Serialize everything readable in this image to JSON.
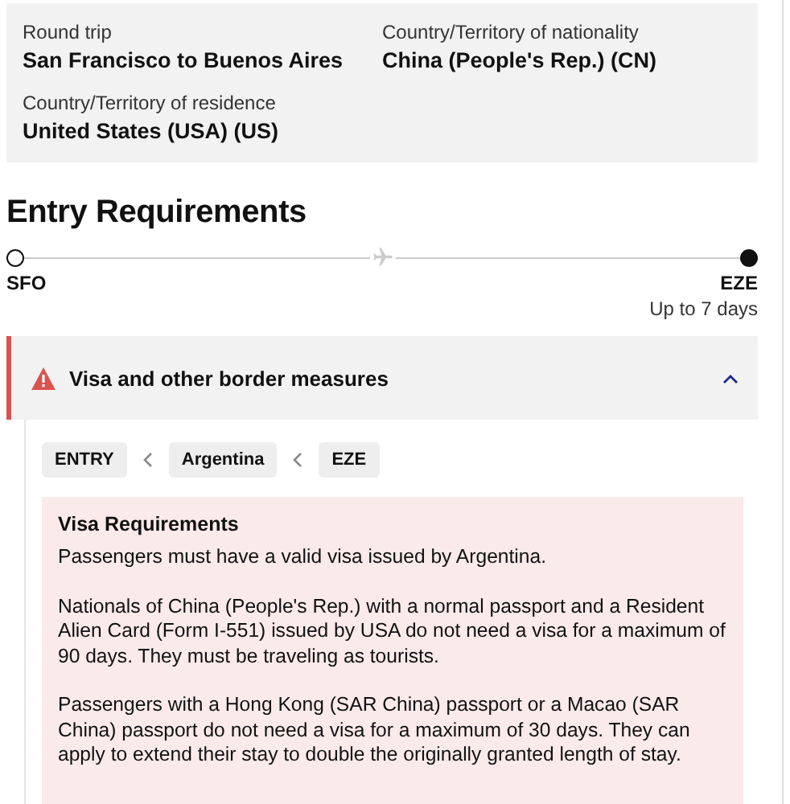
{
  "summary": [
    {
      "label": "Round trip",
      "value": "San Francisco to Buenos Aires"
    },
    {
      "label": "Country/Territory of nationality",
      "value": "China (People's Rep.) (CN)"
    },
    {
      "label": "Country/Territory of residence",
      "value": "United States (USA) (US)"
    }
  ],
  "heading": "Entry Requirements",
  "route": {
    "stops": [
      {
        "code": "SFO",
        "current": false
      },
      {
        "code": "EZE",
        "current": true,
        "note": "Up to 7 days"
      }
    ]
  },
  "section": {
    "title": "Visa and other border measures",
    "expanded": true,
    "breadcrumb": [
      "ENTRY",
      "Argentina",
      "EZE"
    ],
    "notice": {
      "title": "Visa Requirements",
      "paragraphs": [
        "Passengers must have a valid visa issued by Argentina.",
        "Nationals of China (People's Rep.) with a normal passport and a Resident Alien Card (Form I-551) issued by USA do not need a visa for a maximum of 90 days. They must be traveling as tourists.",
        "Passengers with a Hong Kong (SAR China) passport or a Macao (SAR China) passport do not need a visa for a maximum of 30 days. They can apply to extend their stay to double the originally granted length of stay."
      ]
    }
  }
}
